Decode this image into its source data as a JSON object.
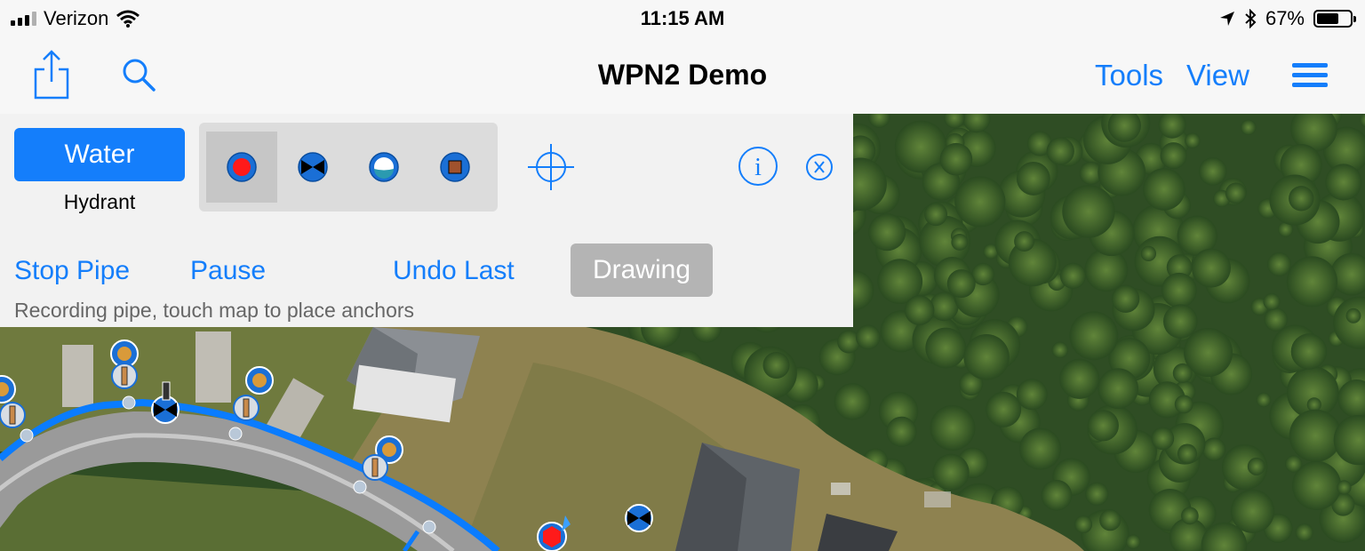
{
  "status_bar": {
    "carrier": "Verizon",
    "time": "11:15 AM",
    "battery_percent": "67%",
    "battery_level": 0.67,
    "icons": [
      "signal-icon",
      "wifi-icon",
      "location-arrow-icon",
      "bluetooth-icon",
      "battery-icon"
    ]
  },
  "nav": {
    "title": "WPN2 Demo",
    "tools_label": "Tools",
    "view_label": "View",
    "icons": [
      "share-icon",
      "search-icon",
      "menu-icon"
    ]
  },
  "panel": {
    "layer_button": "Water",
    "feature_label": "Hydrant",
    "feature_types": [
      "hydrant-icon",
      "valve-icon",
      "tank-icon",
      "meter-icon"
    ],
    "selected_feature_index": 0,
    "actions": {
      "stop_pipe": "Stop Pipe",
      "pause": "Pause",
      "undo_last": "Undo Last",
      "drawing": "Drawing"
    },
    "hint": "Recording pipe, touch map to place anchors"
  },
  "colors": {
    "accent": "#147efb",
    "pipe": "#0a7cff",
    "hydrant_fill": "#ff1a1a",
    "valve_fill": "#000000",
    "meter_fill": "#a0522d",
    "pin_fill": "#d99a3a"
  }
}
